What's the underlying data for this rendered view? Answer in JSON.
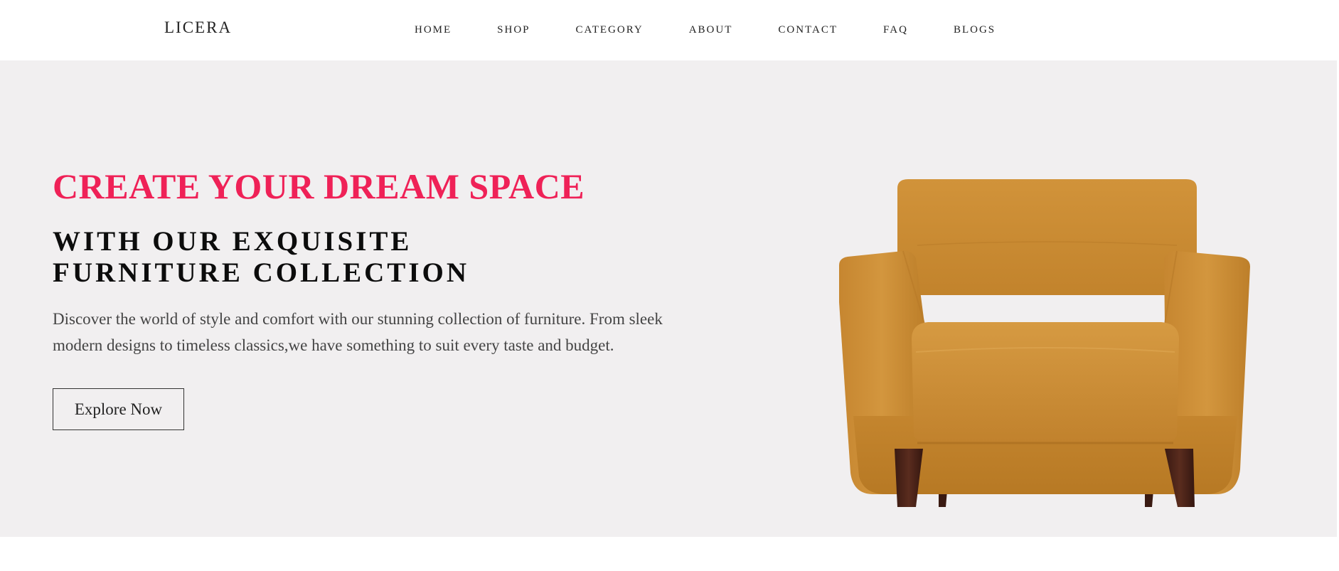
{
  "header": {
    "brand": "LICERA",
    "nav": [
      {
        "label": "HOME"
      },
      {
        "label": "SHOP"
      },
      {
        "label": "CATEGORY"
      },
      {
        "label": "ABOUT"
      },
      {
        "label": "CONTACT"
      },
      {
        "label": "FAQ"
      },
      {
        "label": "BLOGS"
      }
    ]
  },
  "hero": {
    "headline": "CREATE YOUR DREAM SPACE",
    "subheadline": "WITH OUR EXQUISITE FURNITURE COLLECTION",
    "description": "Discover the world of style and comfort with our stunning collection of furniture. From sleek modern designs to timeless classics,we have something to suit every taste and budget.",
    "cta_label": "Explore Now",
    "image": "armchair-image"
  },
  "colors": {
    "accent": "#ef2157",
    "hero_background": "#f1eff0",
    "chair_fabric": "#c98a33",
    "chair_legs": "#4a2218"
  }
}
